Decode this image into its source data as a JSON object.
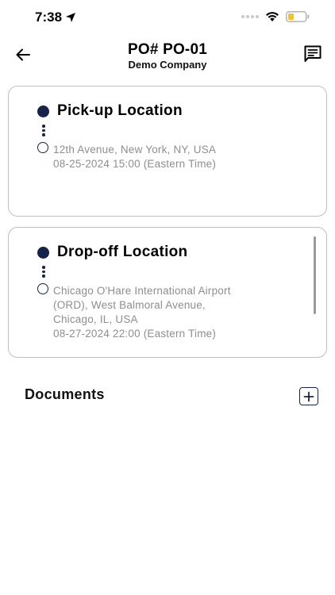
{
  "status_bar": {
    "time": "7:38",
    "icons": [
      "location-arrow-icon",
      "cellular-signal-icon",
      "wifi-icon",
      "battery-icon"
    ]
  },
  "header": {
    "title": "PO# PO-01",
    "subtitle": "Demo Company",
    "icons": [
      "arrow-left-icon",
      "chat-icon"
    ]
  },
  "pickup": {
    "title": "Pick-up Location",
    "address_lines": [
      "12th Avenue, New York, NY, USA"
    ],
    "datetime": "08-25-2024 15:00 (Eastern Time)"
  },
  "dropoff": {
    "title": "Drop-off Location",
    "address_lines": [
      "Chicago O'Hare International Airport",
      "(ORD), West Balmoral Avenue,",
      "Chicago, IL, USA"
    ],
    "datetime": "08-27-2024 22:00 (Eastern Time)"
  },
  "documents": {
    "title": "Documents",
    "add_icon": "plus-square-icon"
  },
  "colors": {
    "accent": "#17244a",
    "muted_text": "#8e8e93",
    "card_border": "#bfbfbf",
    "battery_fill": "#f7c325"
  }
}
